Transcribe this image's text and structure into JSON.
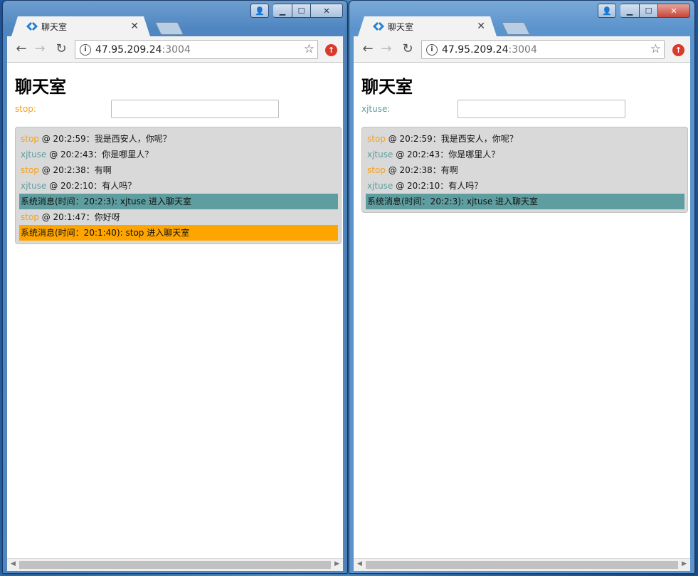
{
  "colors": {
    "stop": "#f5a11c",
    "xjtuse": "#5f9ea0",
    "sys_xjtuse_bg": "#5f9ea0",
    "sys_stop_bg": "#ffa500"
  },
  "windows": [
    {
      "tab_title": "聊天室",
      "url_host": "47.95.209.24",
      "url_port": ":3004",
      "page_title": "聊天室",
      "user_label": "stop:",
      "user_color": "#f5a11c",
      "messages": [
        {
          "type": "chat",
          "author": "stop",
          "color": "#f5a11c",
          "rest": " @ 20:2:59：我是西安人，你呢？"
        },
        {
          "type": "chat",
          "author": "xjtuse",
          "color": "#5f9ea0",
          "rest": " @ 20:2:43：你是哪里人？"
        },
        {
          "type": "chat",
          "author": "stop",
          "color": "#f5a11c",
          "rest": " @ 20:2:38：有啊"
        },
        {
          "type": "chat",
          "author": "xjtuse",
          "color": "#5f9ea0",
          "rest": " @ 20:2:10：有人吗？"
        },
        {
          "type": "system",
          "text": "系统消息(时间：20:2:3): xjtuse 进入聊天室",
          "bg": "#5f9ea0"
        },
        {
          "type": "chat",
          "author": "stop",
          "color": "#f5a11c",
          "rest": " @ 20:1:47：你好呀"
        },
        {
          "type": "system",
          "text": "系统消息(时间：20:1:40): stop 进入聊天室",
          "bg": "#ffa500"
        }
      ]
    },
    {
      "tab_title": "聊天室",
      "url_host": "47.95.209.24",
      "url_port": ":3004",
      "page_title": "聊天室",
      "user_label": "xjtuse:",
      "user_color": "#5f9ea0",
      "messages": [
        {
          "type": "chat",
          "author": "stop",
          "color": "#f5a11c",
          "rest": " @ 20:2:59：我是西安人，你呢？"
        },
        {
          "type": "chat",
          "author": "xjtuse",
          "color": "#5f9ea0",
          "rest": " @ 20:2:43：你是哪里人？"
        },
        {
          "type": "chat",
          "author": "stop",
          "color": "#f5a11c",
          "rest": " @ 20:2:38：有啊"
        },
        {
          "type": "chat",
          "author": "xjtuse",
          "color": "#5f9ea0",
          "rest": " @ 20:2:10：有人吗？"
        },
        {
          "type": "system",
          "text": "系统消息(时间：20:2:3): xjtuse 进入聊天室",
          "bg": "#5f9ea0"
        }
      ]
    }
  ]
}
